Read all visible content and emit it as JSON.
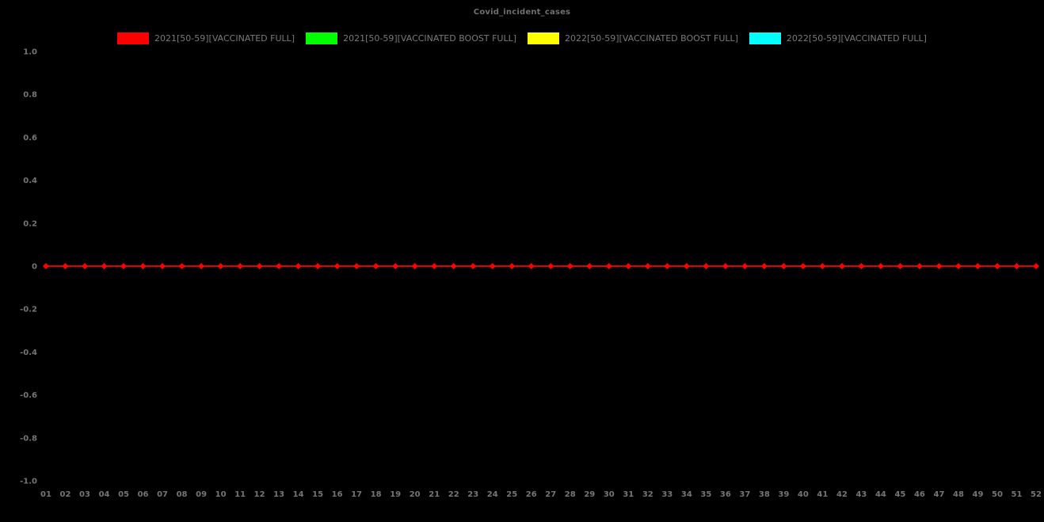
{
  "title": "Covid_incident_cases",
  "colors": {
    "background": "#000000",
    "tick_text": "#757575",
    "title_text": "#6f6f6f",
    "legend_text": "#7a7a7a"
  },
  "legend": {
    "items": [
      {
        "label": "2021[50-59][VACCINATED FULL]",
        "color": "#ff0000"
      },
      {
        "label": "2021[50-59][VACCINATED BOOST FULL]",
        "color": "#00ff00"
      },
      {
        "label": "2022[50-59][VACCINATED BOOST FULL]",
        "color": "#ffff00"
      },
      {
        "label": "2022[50-59][VACCINATED FULL]",
        "color": "#00ffff"
      }
    ]
  },
  "chart_data": {
    "type": "line",
    "title": "Covid_incident_cases",
    "xlabel": "",
    "ylabel": "",
    "x": [
      "01",
      "02",
      "03",
      "04",
      "05",
      "06",
      "07",
      "08",
      "09",
      "10",
      "11",
      "12",
      "13",
      "14",
      "15",
      "16",
      "17",
      "18",
      "19",
      "20",
      "21",
      "22",
      "23",
      "24",
      "25",
      "26",
      "27",
      "28",
      "29",
      "30",
      "31",
      "32",
      "33",
      "34",
      "35",
      "36",
      "37",
      "38",
      "39",
      "40",
      "41",
      "42",
      "43",
      "44",
      "45",
      "46",
      "47",
      "48",
      "49",
      "50",
      "51",
      "52"
    ],
    "ylim": [
      -1.0,
      1.0
    ],
    "ytick_labels": [
      "1.0",
      "0.8",
      "0.6",
      "0.4",
      "0.2",
      "0",
      "-0.2",
      "-0.4",
      "-0.6",
      "-0.8",
      "-1.0"
    ],
    "grid": false,
    "legend_position": "top",
    "series": [
      {
        "name": "2021[50-59][VACCINATED FULL]",
        "color": "#ff0000",
        "marker": "diamond",
        "visible": true,
        "values": [
          0,
          0,
          0,
          0,
          0,
          0,
          0,
          0,
          0,
          0,
          0,
          0,
          0,
          0,
          0,
          0,
          0,
          0,
          0,
          0,
          0,
          0,
          0,
          0,
          0,
          0,
          0,
          0,
          0,
          0,
          0,
          0,
          0,
          0,
          0,
          0,
          0,
          0,
          0,
          0,
          0,
          0,
          0,
          0,
          0,
          0,
          0,
          0,
          0,
          0,
          0,
          0
        ]
      },
      {
        "name": "2021[50-59][VACCINATED BOOST FULL]",
        "color": "#00ff00",
        "marker": "diamond",
        "visible": false,
        "values": []
      },
      {
        "name": "2022[50-59][VACCINATED BOOST FULL]",
        "color": "#ffff00",
        "marker": "diamond",
        "visible": false,
        "values": []
      },
      {
        "name": "2022[50-59][VACCINATED FULL]",
        "color": "#00ffff",
        "marker": "diamond",
        "visible": false,
        "values": []
      }
    ]
  }
}
